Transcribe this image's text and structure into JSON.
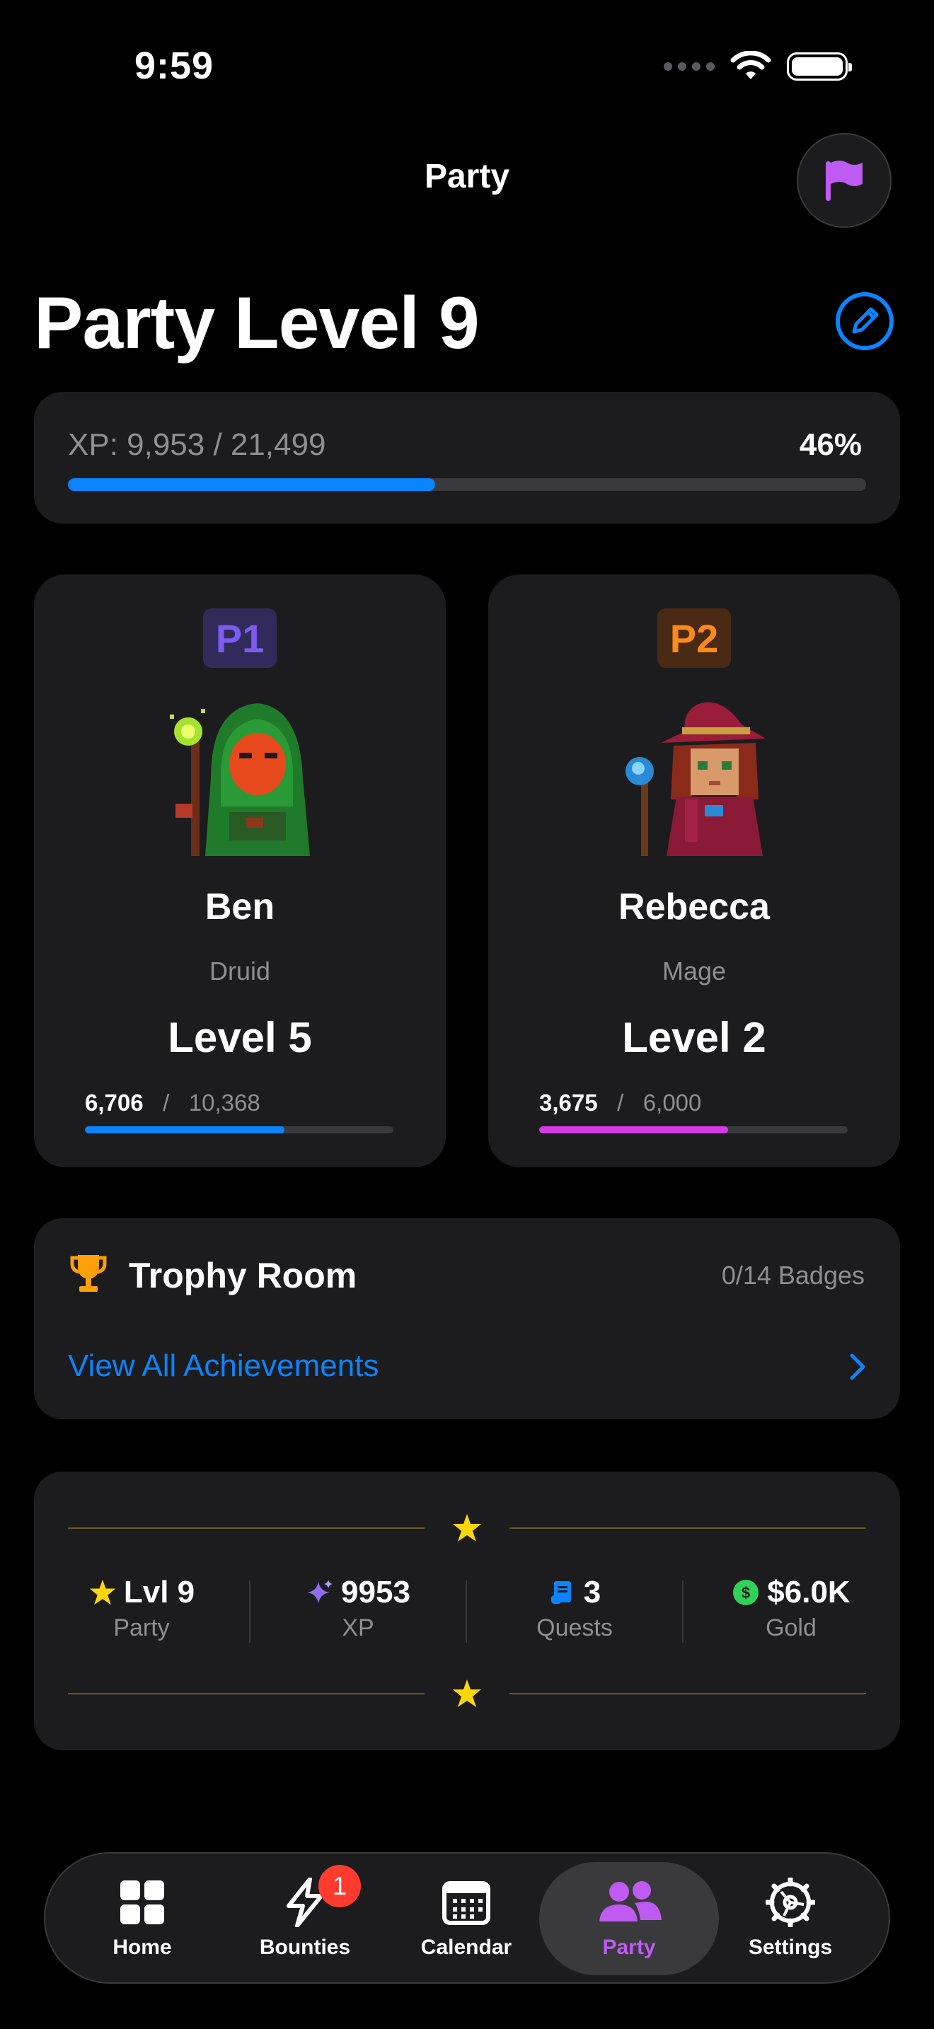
{
  "status_bar": {
    "time": "9:59"
  },
  "nav": {
    "title": "Party"
  },
  "party": {
    "title": "Party Level 9",
    "xp_text": "XP: 9,953 / 21,499",
    "xp_percent_label": "46%",
    "xp_fraction": 0.46
  },
  "players": [
    {
      "badge": "P1",
      "badge_color": "#7d5cf0",
      "badge_bg": "#332a5c",
      "name": "Ben",
      "class": "Druid",
      "level": "Level 5",
      "xp_current": "6,706",
      "xp_sep": "/",
      "xp_max": "10,368",
      "xp_fraction": 0.647,
      "bar_color": "#0a84ff"
    },
    {
      "badge": "P2",
      "badge_color": "#ff8a1c",
      "badge_bg": "#4a2a14",
      "name": "Rebecca",
      "class": "Mage",
      "level": "Level 2",
      "xp_current": "3,675",
      "xp_sep": "/",
      "xp_max": "6,000",
      "xp_fraction": 0.6125,
      "bar_color": "#d63ae6"
    }
  ],
  "trophy": {
    "title": "Trophy Room",
    "count": "0/14 Badges",
    "link": "View All Achievements"
  },
  "stats": [
    {
      "icon": "star-icon",
      "value": "Lvl 9",
      "label": "Party"
    },
    {
      "icon": "sparkle-icon",
      "value": "9953",
      "label": "XP"
    },
    {
      "icon": "scroll-icon",
      "value": "3",
      "label": "Quests"
    },
    {
      "icon": "dollar-coin-icon",
      "value": "$6.0K",
      "label": "Gold"
    }
  ],
  "tabs": [
    {
      "icon": "grid-icon",
      "label": "Home"
    },
    {
      "icon": "bolt-icon",
      "label": "Bounties",
      "badge": "1"
    },
    {
      "icon": "calendar-icon",
      "label": "Calendar"
    },
    {
      "icon": "people-icon",
      "label": "Party",
      "active": true
    },
    {
      "icon": "gear-icon",
      "label": "Settings"
    }
  ],
  "colors": {
    "accent_blue": "#0a84ff",
    "party_purple": "#bf5af2",
    "gold": "#ffd60a",
    "card_bg": "#1c1c1e"
  }
}
